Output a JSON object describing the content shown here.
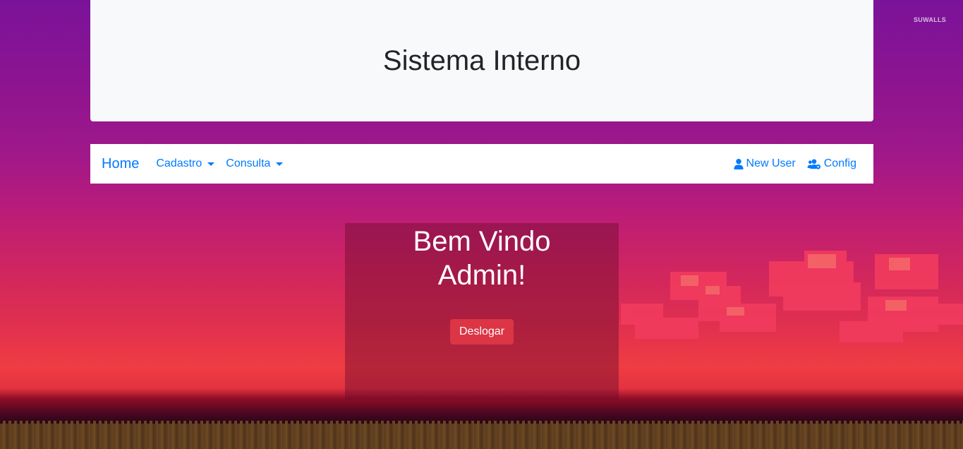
{
  "watermark": "SUWALLS",
  "header": {
    "title": "Sistema Interno"
  },
  "navbar": {
    "brand": "Home",
    "menus": [
      {
        "label": "Cadastro"
      },
      {
        "label": "Consulta"
      }
    ],
    "right": [
      {
        "label": "New User",
        "icon": "user-icon"
      },
      {
        "label": "Config",
        "icon": "users-cog-icon"
      }
    ]
  },
  "welcome": {
    "line1": "Bem Vindo",
    "line2": "Admin!",
    "logout_label": "Deslogar"
  },
  "colors": {
    "primary": "#007bff",
    "danger": "#dc3545",
    "header_bg": "#f8f9fa"
  }
}
